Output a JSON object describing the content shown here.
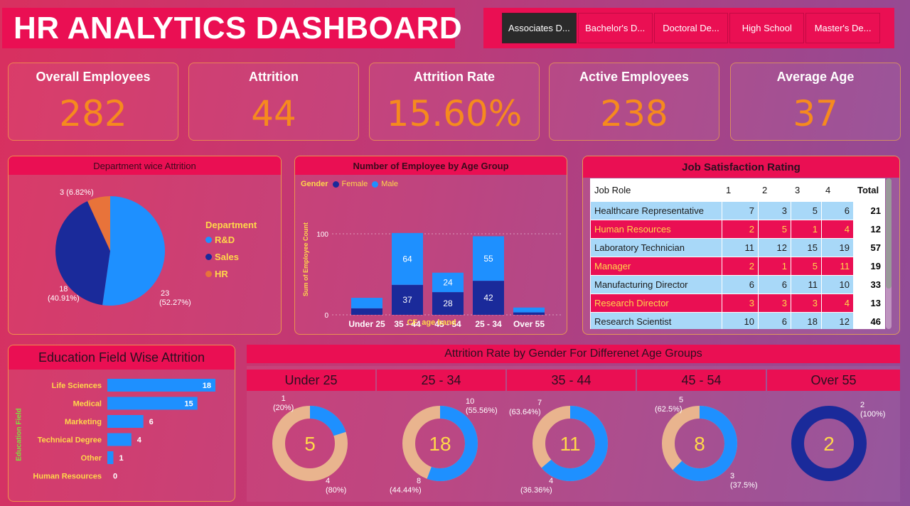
{
  "header": {
    "title": "HR ANALYTICS DASHBOARD",
    "slicer": [
      {
        "label": "Associates D...",
        "selected": true
      },
      {
        "label": "Bachelor's D...",
        "selected": false
      },
      {
        "label": "Doctoral De...",
        "selected": false
      },
      {
        "label": "High School",
        "selected": false
      },
      {
        "label": "Master's De...",
        "selected": false
      }
    ]
  },
  "kpis": [
    {
      "label": "Overall Employees",
      "value": "282"
    },
    {
      "label": "Attrition",
      "value": "44"
    },
    {
      "label": "Attrition Rate",
      "value": "15.60%"
    },
    {
      "label": "Active Employees",
      "value": "238"
    },
    {
      "label": "Average Age",
      "value": "37"
    }
  ],
  "colors": {
    "accent": "#ea0f53",
    "kpi_value": "#f68a1e",
    "legend_text": "#ffd84a",
    "rnd": "#1e90ff",
    "sales": "#1a2a9a",
    "hr": "#e8733a",
    "female": "#1a2a9a",
    "male": "#1e90ff",
    "donut_female": "#e9b48e",
    "donut_male": "#1e90ff",
    "donut_all": "#1a2a9a"
  },
  "dept_chart": {
    "title": "Department wice Attrition",
    "legend_title": "Department",
    "chart_data": {
      "type": "pie",
      "title": "Department wice Attrition",
      "categories": [
        "R&D",
        "Sales",
        "HR"
      ],
      "values": [
        23,
        18,
        3
      ],
      "percents": [
        "52.27%",
        "40.91%",
        "6.82%"
      ]
    },
    "labels": {
      "hr": "3 (6.82%)",
      "sales_count": "18",
      "sales_pct": "(40.91%)",
      "rnd_count": "23",
      "rnd_pct": "(52.27%)"
    }
  },
  "age_chart": {
    "title": "Number of Employee by Age Group",
    "legend_title": "Gender",
    "legend": [
      "Female",
      "Male"
    ],
    "ylabel": "Sum of Employee Count",
    "xlabel": "CF_age band",
    "yticks": [
      "100",
      "0"
    ],
    "chart_data": {
      "type": "bar",
      "stacked": true,
      "categories": [
        "Under 25",
        "35 - 44",
        "45 - 54",
        "25 - 34",
        "Over 55"
      ],
      "series": [
        {
          "name": "Female",
          "values": [
            8,
            37,
            28,
            42,
            3
          ]
        },
        {
          "name": "Male",
          "values": [
            13,
            64,
            24,
            55,
            6
          ]
        }
      ],
      "ylim": [
        0,
        115
      ],
      "data_labels": {
        "Female": [
          "",
          "37",
          "28",
          "42",
          ""
        ],
        "Male": [
          "",
          "64",
          "24",
          "55",
          ""
        ]
      }
    }
  },
  "job_satisfaction": {
    "title": "Job Satisfaction Rating",
    "columns": [
      "Job Role",
      "1",
      "2",
      "3",
      "4",
      "Total"
    ],
    "rows": [
      {
        "role": "Healthcare Representative",
        "v": [
          "7",
          "3",
          "5",
          "6"
        ],
        "total": "21"
      },
      {
        "role": "Human Resources",
        "v": [
          "2",
          "5",
          "1",
          "4"
        ],
        "total": "12"
      },
      {
        "role": "Laboratory Technician",
        "v": [
          "11",
          "12",
          "15",
          "19"
        ],
        "total": "57"
      },
      {
        "role": "Manager",
        "v": [
          "2",
          "1",
          "5",
          "11"
        ],
        "total": "19"
      },
      {
        "role": "Manufacturing Director",
        "v": [
          "6",
          "6",
          "11",
          "10"
        ],
        "total": "33"
      },
      {
        "role": "Research Director",
        "v": [
          "3",
          "3",
          "3",
          "4"
        ],
        "total": "13"
      },
      {
        "role": "Research Scientist",
        "v": [
          "10",
          "6",
          "18",
          "12"
        ],
        "total": "46"
      }
    ]
  },
  "education_chart": {
    "title": "Education Field Wise Attrition",
    "ylabel": "Education Field",
    "chart_data": {
      "type": "bar",
      "orientation": "horizontal",
      "categories": [
        "Life Sciences",
        "Medical",
        "Marketing",
        "Technical Degree",
        "Other",
        "Human Resources"
      ],
      "values": [
        18,
        15,
        6,
        4,
        1,
        0
      ],
      "xlim": [
        0,
        18
      ]
    }
  },
  "gender_age": {
    "title": "Attrition Rate by Gender For Differenet Age Groups",
    "bands": [
      {
        "name": "Under 25",
        "total": "5",
        "male_frac": 0.2,
        "lbl1_count": "1",
        "lbl1_pct": "(20%)",
        "lbl2_count": "4",
        "lbl2_pct": "(80%)"
      },
      {
        "name": "25 - 34",
        "total": "18",
        "male_frac": 0.5556,
        "lbl1_count": "10",
        "lbl1_pct": "(55.56%)",
        "lbl2_count": "8",
        "lbl2_pct": "(44.44%)"
      },
      {
        "name": "35 - 44",
        "total": "11",
        "male_frac": 0.6364,
        "lbl1_count": "7",
        "lbl1_pct": "(63.64%)",
        "lbl2_count": "4",
        "lbl2_pct": "(36.36%)"
      },
      {
        "name": "45 - 54",
        "total": "8",
        "male_frac": 0.625,
        "lbl1_count": "5",
        "lbl1_pct": "(62.5%)",
        "lbl2_count": "3",
        "lbl2_pct": "(37.5%)"
      },
      {
        "name": "Over 55",
        "total": "2",
        "male_frac": 1.0,
        "lbl1_count": "2",
        "lbl1_pct": "(100%)",
        "lbl2_count": "",
        "lbl2_pct": ""
      }
    ]
  }
}
